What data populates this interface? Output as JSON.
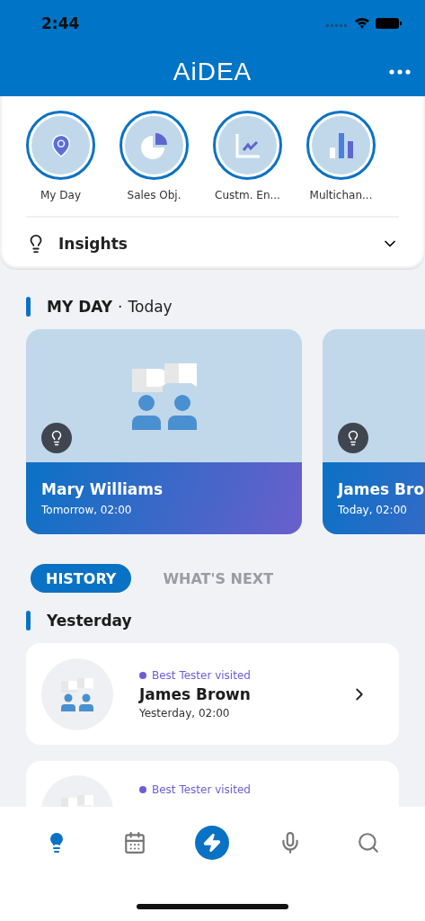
{
  "status_bar": {
    "time": "2:44"
  },
  "header": {
    "title": "AiDEA"
  },
  "shortcuts": [
    {
      "label": "My Day",
      "kind": "pin"
    },
    {
      "label": "Sales Obj.",
      "kind": "pie"
    },
    {
      "label": "Custm. En...",
      "kind": "line"
    },
    {
      "label": "Multichan...",
      "kind": "bars"
    }
  ],
  "insights": {
    "label": "Insights",
    "expanded": false
  },
  "my_day": {
    "title": "MY DAY",
    "separator": "·",
    "subtitle": "Today",
    "cards": [
      {
        "name": "Mary Williams",
        "time": "Tomorrow, 02:00"
      },
      {
        "name": "James Bro",
        "time": "Today, 02:00"
      }
    ]
  },
  "tabs": [
    {
      "label": "HISTORY",
      "selected": true
    },
    {
      "label": "WHAT'S NEXT",
      "selected": false
    }
  ],
  "history": {
    "group": "Yesterday",
    "items": [
      {
        "status": "Best Tester visited",
        "color": "#6a5fd6",
        "name": "James Brown",
        "time": "Yesterday, 02:00"
      },
      {
        "status": "Best Tester visited",
        "color": "#6a5fd6"
      }
    ]
  },
  "nav": [
    {
      "kind": "insights",
      "selected": true
    },
    {
      "kind": "calendar",
      "selected": false
    },
    {
      "kind": "action",
      "selected": false
    },
    {
      "kind": "voice",
      "selected": false
    },
    {
      "kind": "search",
      "selected": false
    }
  ]
}
